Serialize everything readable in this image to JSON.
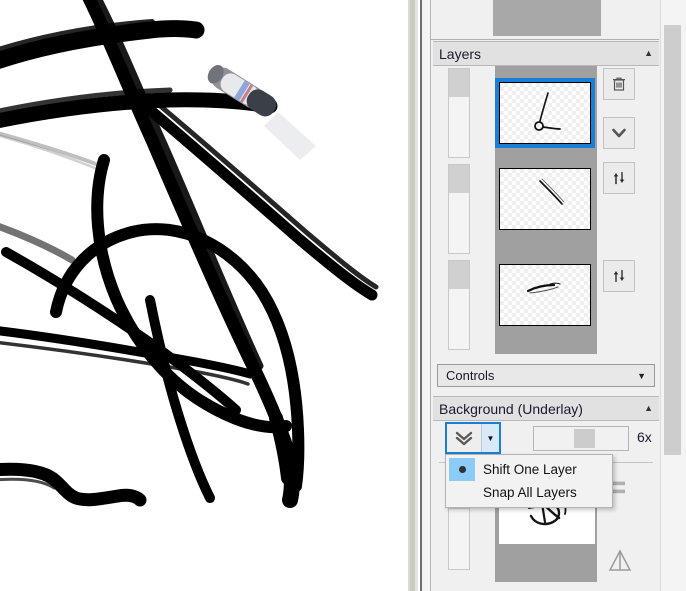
{
  "app": {
    "zoom_label": "6x"
  },
  "canvas": {
    "name": "drawing-canvas",
    "cursor": "stylus-pen-cursor",
    "background_color": "#ffffff",
    "ink_color": "#000000"
  },
  "panel": {
    "sections": [
      {
        "id": "layers",
        "title": "Layers",
        "collapse_caret": "▲",
        "expanded": true
      },
      {
        "id": "background",
        "title": "Background (Underlay)",
        "collapse_caret": "▲",
        "expanded": true
      }
    ],
    "layers": [
      {
        "name": "layer-1",
        "selected": true,
        "opacity_handle_position": "top",
        "thumbnail": "sketch-arrow-hook",
        "transparent": true
      },
      {
        "name": "layer-2",
        "selected": false,
        "opacity_handle_position": "top",
        "thumbnail": "sketch-diagonal-stroke",
        "transparent": true
      },
      {
        "name": "layer-3",
        "selected": false,
        "opacity_handle_position": "top",
        "thumbnail": "sketch-small-curve",
        "transparent": true
      }
    ],
    "layer_tools": [
      {
        "name": "delete-layer-button",
        "icon": "trash-icon"
      },
      {
        "name": "merge-down-button",
        "icon": "chevron-down-icon"
      },
      {
        "name": "reorder-layer-button",
        "icon": "up-down-arrows-icon"
      },
      {
        "name": "reorder-layer-button-2",
        "icon": "up-down-arrows-icon"
      }
    ],
    "controls_combo": {
      "label": "Controls",
      "caret": "▼"
    },
    "background_section": {
      "shift_button": {
        "name": "shift-layer-button",
        "icon": "double-chevron-down-icon",
        "dropdown_caret": "▼",
        "focused": true
      },
      "zoom_slider": {
        "name": "underlay-zoom-slider",
        "value_label": "6x"
      },
      "underlay_layer": {
        "name": "underlay-layer-row",
        "thumbnail": "sketch-scribble-loop",
        "opacity_handle_position": "top"
      },
      "tools": [
        {
          "name": "list-view-button",
          "icon": "list-icon"
        },
        {
          "name": "mirror-button",
          "icon": "triangle-mirror-icon"
        }
      ]
    },
    "dropdown_menu": {
      "name": "shift-mode-menu",
      "open": true,
      "items": [
        {
          "label": "Shift One Layer",
          "checked": true
        },
        {
          "label": "Snap All Layers",
          "checked": false
        }
      ]
    },
    "scrollbar": {
      "name": "panel-vertical-scrollbar"
    }
  },
  "colors": {
    "accent": "#1a7fd4",
    "menu_highlight": "#8ccbf5",
    "panel_bg": "#f0f0f0",
    "header_bg": "#e1e1e1",
    "thumb_frame": "#a0a0a0"
  }
}
